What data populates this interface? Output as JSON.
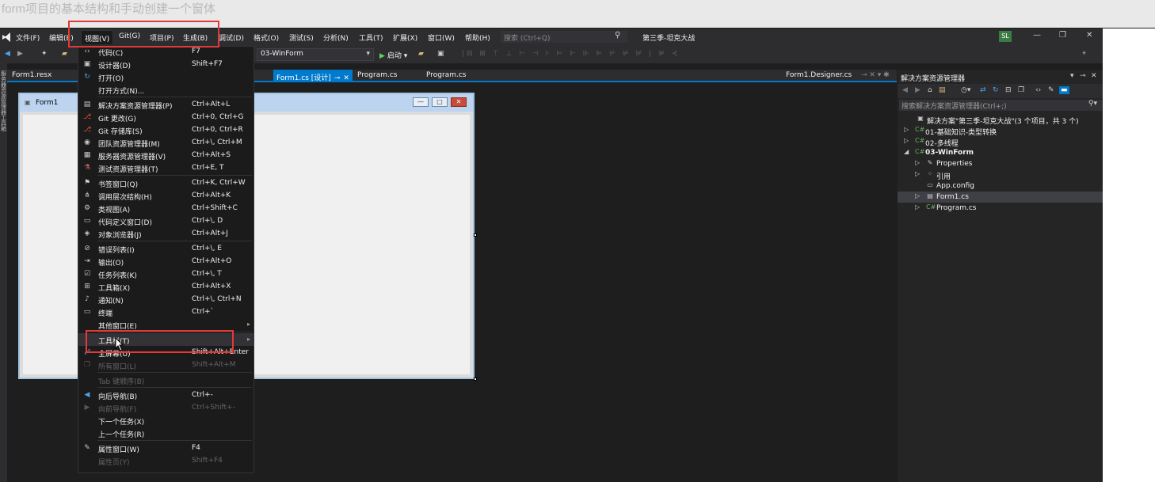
{
  "doc_title": "form项目的基本结构和手动创建一个窗体",
  "menubar": {
    "items": [
      "文件(F)",
      "编辑(E)",
      "视图(V)",
      "Git(G)",
      "项目(P)",
      "生成(B)",
      "调试(D)",
      "格式(O)",
      "测试(S)",
      "分析(N)",
      "工具(T)",
      "扩展(X)",
      "窗口(W)",
      "帮助(H)"
    ],
    "search_placeholder": "搜索 (Ctrl+Q)",
    "solution_name": "第三季-坦克大战",
    "avatar": "SL"
  },
  "toolbar": {
    "project": "03-WinForm",
    "start": "启动"
  },
  "left_strip_text": "服务器资源管理器工具箱",
  "tabs": [
    {
      "label": "Form1.resx",
      "active": false
    },
    {
      "label": "Form1.cs [设计]",
      "active": true
    },
    {
      "label": "Program.cs",
      "active": false
    },
    {
      "label": "Program.cs",
      "active": false
    },
    {
      "label": "Form1.Designer.cs",
      "active": false
    }
  ],
  "form": {
    "title": "Form1"
  },
  "view_menu": {
    "items": [
      {
        "label": "代码(C)",
        "shortcut": "F7",
        "icon": "code-icon",
        "disabled": false
      },
      {
        "label": "设计器(D)",
        "shortcut": "Shift+F7",
        "icon": "designer-icon",
        "disabled": false
      },
      {
        "label": "打开(O)",
        "shortcut": "",
        "icon": "open-icon",
        "disabled": false
      },
      {
        "label": "打开方式(N)...",
        "shortcut": "",
        "icon": "",
        "disabled": false
      },
      {
        "label": "解决方案资源管理器(P)",
        "shortcut": "Ctrl+Alt+L",
        "icon": "solution-explorer-icon",
        "disabled": false,
        "sep": true
      },
      {
        "label": "Git 更改(G)",
        "shortcut": "Ctrl+0, Ctrl+G",
        "icon": "git-changes-icon",
        "disabled": false
      },
      {
        "label": "Git 存储库(S)",
        "shortcut": "Ctrl+0, Ctrl+R",
        "icon": "git-repo-icon",
        "disabled": false
      },
      {
        "label": "团队资源管理器(M)",
        "shortcut": "Ctrl+\\, Ctrl+M",
        "icon": "team-explorer-icon",
        "disabled": false
      },
      {
        "label": "服务器资源管理器(V)",
        "shortcut": "Ctrl+Alt+S",
        "icon": "server-explorer-icon",
        "disabled": false
      },
      {
        "label": "测试资源管理器(T)",
        "shortcut": "Ctrl+E, T",
        "icon": "test-explorer-icon",
        "disabled": false
      },
      {
        "label": "书签窗口(Q)",
        "shortcut": "Ctrl+K, Ctrl+W",
        "icon": "bookmark-icon",
        "disabled": false,
        "sep": true
      },
      {
        "label": "调用层次结构(H)",
        "shortcut": "Ctrl+Alt+K",
        "icon": "call-hierarchy-icon",
        "disabled": false
      },
      {
        "label": "类视图(A)",
        "shortcut": "Ctrl+Shift+C",
        "icon": "class-view-icon",
        "disabled": false
      },
      {
        "label": "代码定义窗口(D)",
        "shortcut": "Ctrl+\\, D",
        "icon": "code-definition-icon",
        "disabled": false
      },
      {
        "label": "对象浏览器(J)",
        "shortcut": "Ctrl+Alt+J",
        "icon": "object-browser-icon",
        "disabled": false
      },
      {
        "label": "错误列表(I)",
        "shortcut": "Ctrl+\\, E",
        "icon": "error-list-icon",
        "disabled": false,
        "sep": true
      },
      {
        "label": "输出(O)",
        "shortcut": "Ctrl+Alt+O",
        "icon": "output-icon",
        "disabled": false
      },
      {
        "label": "任务列表(K)",
        "shortcut": "Ctrl+\\, T",
        "icon": "task-list-icon",
        "disabled": false
      },
      {
        "label": "工具箱(X)",
        "shortcut": "Ctrl+Alt+X",
        "icon": "toolbox-icon",
        "disabled": false
      },
      {
        "label": "通知(N)",
        "shortcut": "Ctrl+\\, Ctrl+N",
        "icon": "bell-icon",
        "disabled": false
      },
      {
        "label": "终端",
        "shortcut": "Ctrl+`",
        "icon": "terminal-icon",
        "disabled": false
      },
      {
        "label": "其他窗口(E)",
        "shortcut": "",
        "icon": "",
        "disabled": false,
        "submenu": true
      },
      {
        "label": "工具栏(T)",
        "shortcut": "",
        "icon": "",
        "disabled": false,
        "submenu": true,
        "highlight": true,
        "sep": true
      },
      {
        "label": "全屏幕(U)",
        "shortcut": "Shift+Alt+Enter",
        "icon": "fullscreen-icon",
        "disabled": false
      },
      {
        "label": "所有窗口(L)",
        "shortcut": "Shift+Alt+M",
        "icon": "all-windows-icon",
        "disabled": true
      },
      {
        "label": "Tab 键顺序(B)",
        "shortcut": "",
        "icon": "",
        "disabled": true,
        "sep": true
      },
      {
        "label": "向后导航(B)",
        "shortcut": "Ctrl+-",
        "icon": "back-icon",
        "disabled": false,
        "sep": true
      },
      {
        "label": "向前导航(F)",
        "shortcut": "Ctrl+Shift+-",
        "icon": "forward-icon",
        "disabled": true
      },
      {
        "label": "下一个任务(X)",
        "shortcut": "",
        "icon": "",
        "disabled": false
      },
      {
        "label": "上一个任务(R)",
        "shortcut": "",
        "icon": "",
        "disabled": false
      },
      {
        "label": "属性窗口(W)",
        "shortcut": "F4",
        "icon": "wrench-icon",
        "disabled": false,
        "sep": true
      },
      {
        "label": "属性页(Y)",
        "shortcut": "Shift+F4",
        "icon": "",
        "disabled": true
      }
    ]
  },
  "solution_explorer": {
    "title": "解决方案资源管理器",
    "search_placeholder": "搜索解决方案资源管理器(Ctrl+;)",
    "tree": [
      {
        "label": "解决方案\"第三季-坦克大战\"(3 个项目，共 3 个)",
        "level": 0,
        "arrow": "",
        "icon": "solution-icon",
        "bold": false,
        "selected": false
      },
      {
        "label": "01-基础知识-类型转换",
        "level": 1,
        "arrow": "▷",
        "icon": "csproj-icon",
        "bold": false,
        "selected": false
      },
      {
        "label": "02-多线程",
        "level": 1,
        "arrow": "▷",
        "icon": "csproj-icon",
        "bold": false,
        "selected": false
      },
      {
        "label": "03-WinForm",
        "level": 1,
        "arrow": "◢",
        "icon": "csproj-icon",
        "bold": true,
        "selected": false
      },
      {
        "label": "Properties",
        "level": 2,
        "arrow": "▷",
        "icon": "wrench-icon",
        "bold": false,
        "selected": false
      },
      {
        "label": "引用",
        "level": 2,
        "arrow": "▷",
        "icon": "references-icon",
        "bold": false,
        "selected": false
      },
      {
        "label": "App.config",
        "level": 2,
        "arrow": "",
        "icon": "config-file-icon",
        "bold": false,
        "selected": false
      },
      {
        "label": "Form1.cs",
        "level": 2,
        "arrow": "▷",
        "icon": "form-file-icon",
        "bold": false,
        "selected": true
      },
      {
        "label": "Program.cs",
        "level": 2,
        "arrow": "▷",
        "icon": "csharp-file-icon",
        "bold": false,
        "selected": false
      }
    ]
  },
  "colors": {
    "accent": "#007acc",
    "annotation": "#e53935",
    "menu_bg": "#1b1b1c",
    "chrome_bg": "#2d2d30"
  }
}
